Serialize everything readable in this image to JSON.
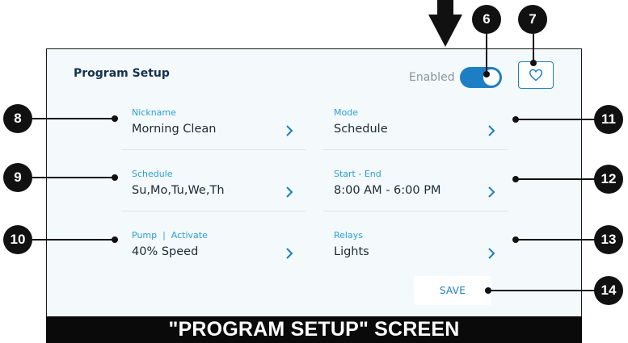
{
  "screen": {
    "title": "Program Setup",
    "enabled_label": "Enabled",
    "enabled": true,
    "accent_color": "#1c7fc4",
    "favorite_icon": "heart-outline-icon"
  },
  "fields": [
    {
      "label": "Nickname",
      "value": "Morning Clean"
    },
    {
      "label": "Mode",
      "value": "Schedule"
    },
    {
      "label": "Schedule",
      "value": "Su,Mo,Tu,We,Th"
    },
    {
      "label": "Start - End",
      "value": "8:00 AM - 6:00 PM"
    },
    {
      "label": "Pump  |  Activate",
      "value": "40% Speed"
    },
    {
      "label": "Relays",
      "value": "Lights"
    }
  ],
  "save_label": "SAVE",
  "caption": "\"PROGRAM SETUP\" SCREEN",
  "callouts": [
    "6",
    "7",
    "8",
    "9",
    "10",
    "11",
    "12",
    "13",
    "14"
  ]
}
